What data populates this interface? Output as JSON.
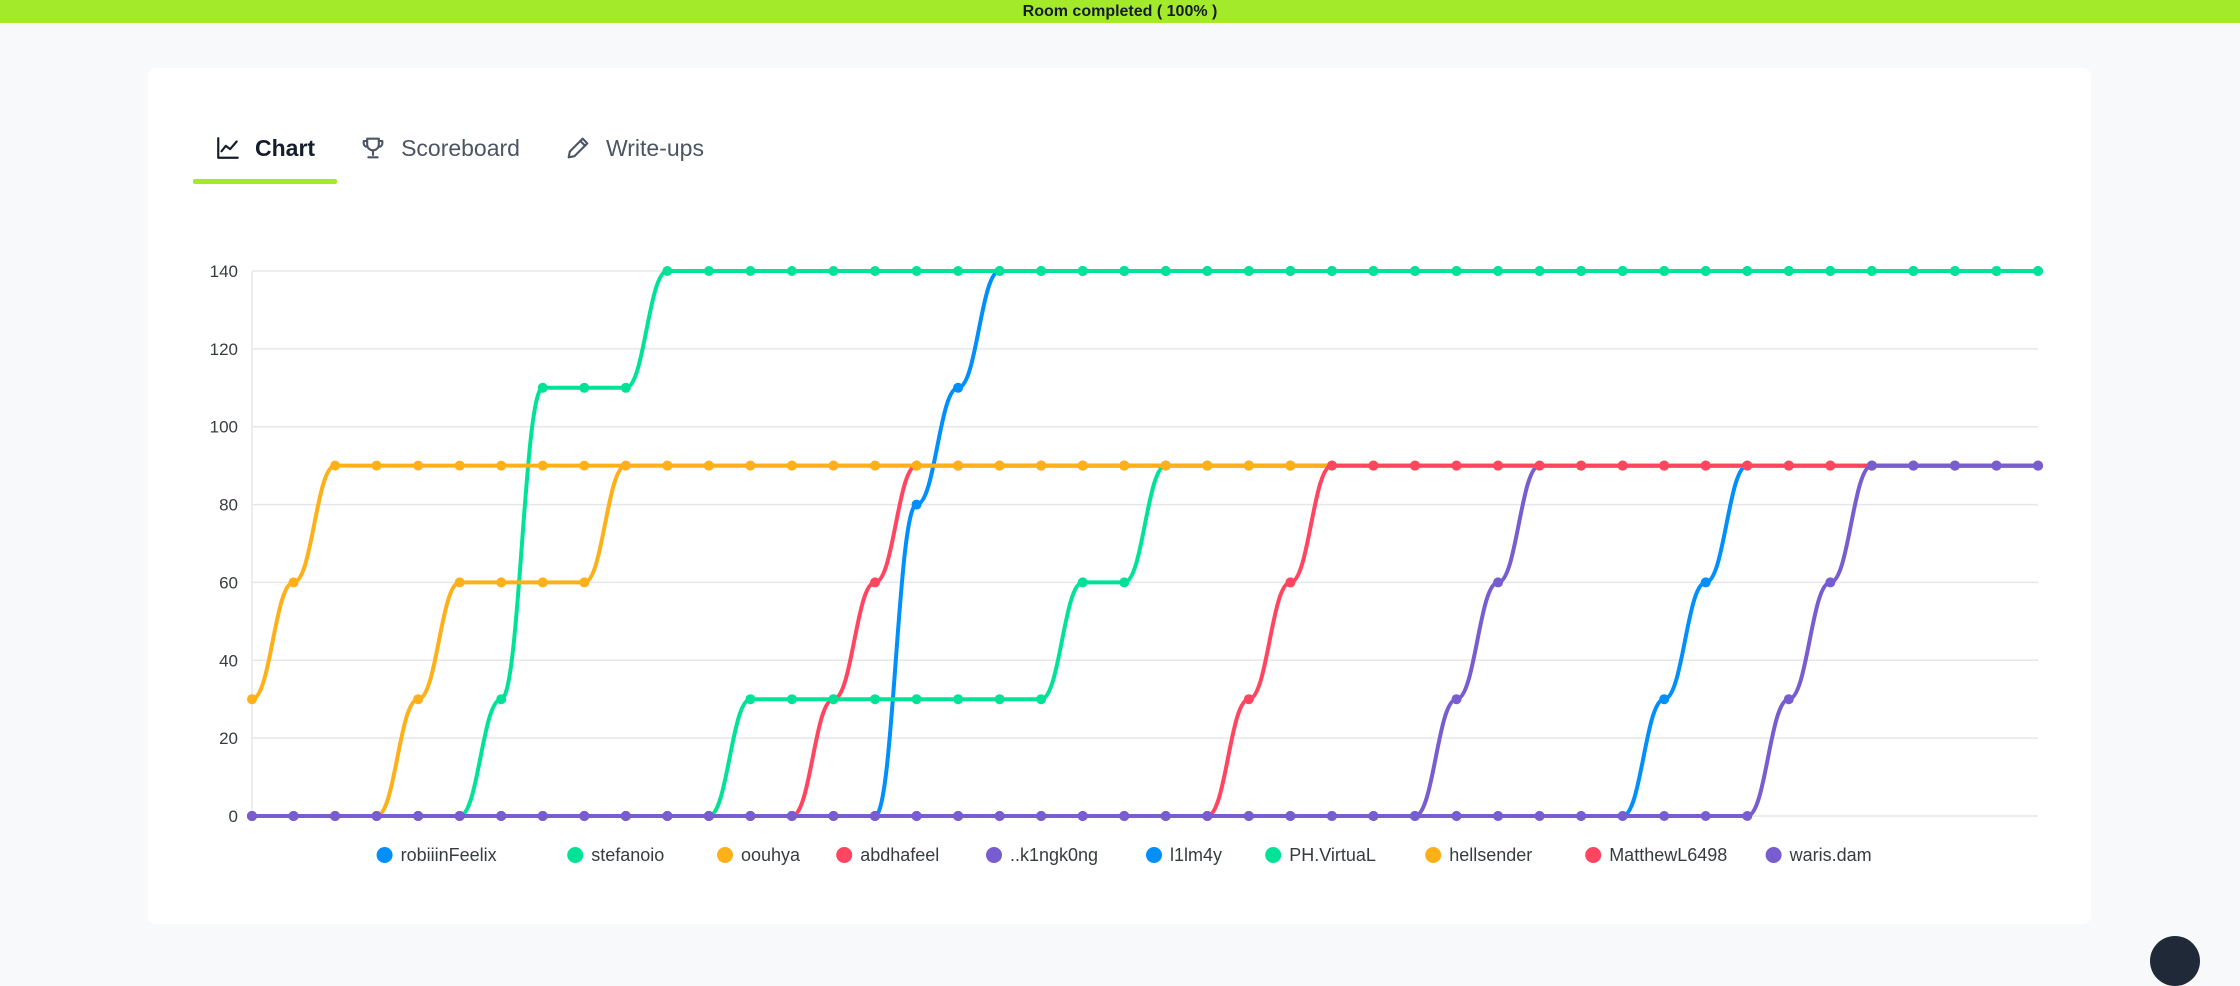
{
  "banner": {
    "text": "Room completed ( 100% )"
  },
  "tabs": [
    {
      "label": "Chart",
      "icon": "line-chart-icon",
      "active": true
    },
    {
      "label": "Scoreboard",
      "icon": "trophy-icon",
      "active": false
    },
    {
      "label": "Write-ups",
      "icon": "pencil-icon",
      "active": false
    }
  ],
  "chart_data": {
    "type": "line",
    "title": "",
    "xlabel": "",
    "ylabel": "",
    "ylim": [
      0,
      140
    ],
    "yticks": [
      0,
      20,
      40,
      60,
      80,
      100,
      120,
      140
    ],
    "grid": true,
    "legend": "bottom",
    "x": [
      1,
      2,
      3,
      4,
      5,
      6,
      7,
      8,
      9,
      10,
      11,
      12,
      13,
      14,
      15,
      16,
      17,
      18,
      19,
      20,
      21,
      22,
      23,
      24,
      25,
      26,
      27,
      28,
      29,
      30,
      31,
      32,
      33,
      34,
      35,
      36,
      37,
      38,
      39,
      40,
      41,
      42,
      43,
      44
    ],
    "series": [
      {
        "name": "robiiinFeelix",
        "color": "#008ffb",
        "values": [
          0,
          0,
          0,
          0,
          0,
          0,
          0,
          0,
          0,
          0,
          0,
          0,
          0,
          0,
          0,
          0,
          80,
          110,
          140,
          140,
          140,
          140,
          140,
          140,
          140,
          140,
          140,
          140,
          140,
          140,
          140,
          140,
          140,
          140,
          140,
          140,
          140,
          140,
          140,
          140,
          140,
          140,
          140,
          140
        ]
      },
      {
        "name": "stefanoio",
        "color": "#00e396",
        "values": [
          0,
          0,
          0,
          0,
          0,
          0,
          30,
          110,
          110,
          110,
          140,
          140,
          140,
          140,
          140,
          140,
          140,
          140,
          140,
          140,
          140,
          140,
          140,
          140,
          140,
          140,
          140,
          140,
          140,
          140,
          140,
          140,
          140,
          140,
          140,
          140,
          140,
          140,
          140,
          140,
          140,
          140,
          140,
          140
        ]
      },
      {
        "name": "oouhya",
        "color": "#feb019",
        "values": [
          30,
          60,
          90,
          90,
          90,
          90,
          90,
          90,
          90,
          90,
          90,
          90,
          90,
          90,
          90,
          90,
          90,
          90,
          90,
          90,
          90,
          90,
          90,
          90,
          90,
          90,
          90,
          90,
          90,
          90,
          90,
          90,
          90,
          90,
          90,
          90,
          90,
          90,
          90,
          90,
          90,
          90,
          90,
          90
        ]
      },
      {
        "name": "abdhafeel",
        "color": "#ff4560",
        "values": [
          0,
          0,
          0,
          0,
          0,
          0,
          0,
          0,
          0,
          0,
          0,
          0,
          0,
          0,
          30,
          60,
          90,
          90,
          90,
          90,
          90,
          90,
          90,
          90,
          90,
          90,
          90,
          90,
          90,
          90,
          90,
          90,
          90,
          90,
          90,
          90,
          90,
          90,
          90,
          90,
          90,
          90,
          90,
          90
        ]
      },
      {
        "name": "..k1ngk0ng",
        "color": "#775dd0",
        "values": [
          0,
          0,
          0,
          0,
          0,
          0,
          0,
          0,
          0,
          0,
          0,
          0,
          0,
          0,
          0,
          0,
          0,
          0,
          0,
          0,
          0,
          0,
          0,
          0,
          0,
          0,
          0,
          0,
          0,
          30,
          60,
          90,
          90,
          90,
          90,
          90,
          90,
          90,
          90,
          90,
          90,
          90,
          90,
          90
        ]
      },
      {
        "name": "l1lm4y",
        "color": "#008ffb",
        "values": [
          0,
          0,
          0,
          0,
          0,
          0,
          0,
          0,
          0,
          0,
          0,
          0,
          0,
          0,
          0,
          0,
          0,
          0,
          0,
          0,
          0,
          0,
          0,
          0,
          0,
          0,
          0,
          0,
          0,
          0,
          0,
          0,
          0,
          0,
          30,
          60,
          90,
          90,
          90,
          90,
          90,
          90,
          90,
          90
        ]
      },
      {
        "name": "PH.VirtuaL",
        "color": "#00e396",
        "values": [
          0,
          0,
          0,
          0,
          0,
          0,
          0,
          0,
          0,
          0,
          0,
          0,
          30,
          30,
          30,
          30,
          30,
          30,
          30,
          30,
          60,
          60,
          90,
          90,
          90,
          90,
          90,
          90,
          90,
          90,
          90,
          90,
          90,
          90,
          90,
          90,
          90,
          90,
          90,
          90,
          90,
          90,
          90,
          90
        ]
      },
      {
        "name": "hellsender",
        "color": "#feb019",
        "values": [
          0,
          0,
          0,
          0,
          30,
          60,
          60,
          60,
          60,
          90,
          90,
          90,
          90,
          90,
          90,
          90,
          90,
          90,
          90,
          90,
          90,
          90,
          90,
          90,
          90,
          90,
          90,
          90,
          90,
          90,
          90,
          90,
          90,
          90,
          90,
          90,
          90,
          90,
          90,
          90,
          90,
          90,
          90,
          90
        ]
      },
      {
        "name": "MatthewL6498",
        "color": "#ff4560",
        "values": [
          0,
          0,
          0,
          0,
          0,
          0,
          0,
          0,
          0,
          0,
          0,
          0,
          0,
          0,
          0,
          0,
          0,
          0,
          0,
          0,
          0,
          0,
          0,
          0,
          30,
          60,
          90,
          90,
          90,
          90,
          90,
          90,
          90,
          90,
          90,
          90,
          90,
          90,
          90,
          90,
          90,
          90,
          90,
          90
        ]
      },
      {
        "name": "waris.dam",
        "color": "#775dd0",
        "values": [
          0,
          0,
          0,
          0,
          0,
          0,
          0,
          0,
          0,
          0,
          0,
          0,
          0,
          0,
          0,
          0,
          0,
          0,
          0,
          0,
          0,
          0,
          0,
          0,
          0,
          0,
          0,
          0,
          0,
          0,
          0,
          0,
          0,
          0,
          0,
          0,
          0,
          30,
          60,
          90,
          90,
          90,
          90,
          90
        ]
      }
    ]
  }
}
